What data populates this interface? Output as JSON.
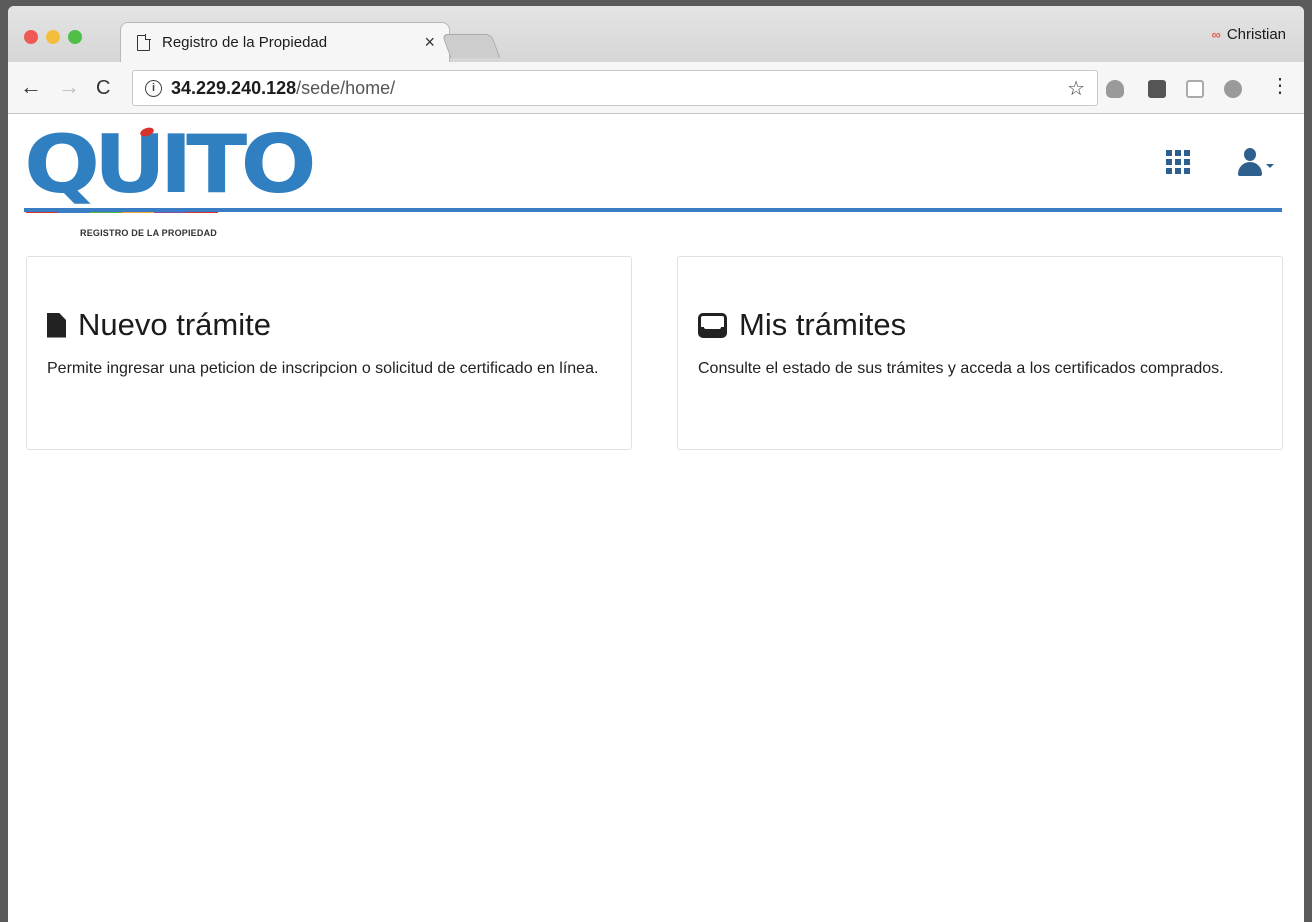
{
  "browser": {
    "tab_title": "Registro de la Propiedad",
    "tab_close": "×",
    "profile_name": "Christian",
    "profile_icon": "∞",
    "url_host": "34.229.240.128",
    "url_path": "/sede/home/",
    "info_icon": "i",
    "star_icon": "☆",
    "back_icon": "←",
    "forward_icon": "→",
    "reload_icon": "C",
    "menu_icon": "⋮"
  },
  "header": {
    "logo_text": "QUITO",
    "logo_subtitle": "REGISTRO DE LA PROPIEDAD",
    "logo_stripe_colors": [
      "#d9322d",
      "#3a7dc4",
      "#5bb448",
      "#f0a830",
      "#8a4f9e",
      "#d9322d"
    ],
    "accent_color": "#3a7dc4"
  },
  "cards": [
    {
      "title": "Nuevo trámite",
      "description": "Permite ingresar una peticion de inscripcion o solicitud de certificado en línea.",
      "icon": "file-icon"
    },
    {
      "title": "Mis trámites",
      "description": "Consulte el estado de sus trámites y acceda a los certificados comprados.",
      "icon": "inbox-icon"
    }
  ]
}
